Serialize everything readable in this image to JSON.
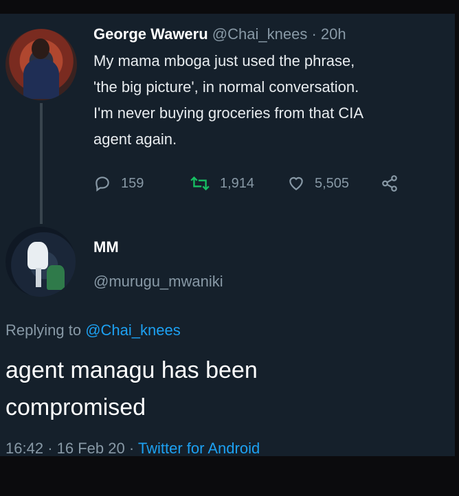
{
  "original_tweet": {
    "author_name": "George Waweru",
    "handle": "@Chai_knees",
    "separator": "·",
    "age": "20h",
    "text": "My mama mboga just used the phrase,\n'the big picture', in normal conversation.\nI'm never buying groceries from that CIA\nagent again.",
    "replies": "159",
    "retweets": "1,914",
    "likes": "5,505"
  },
  "reply_tweet": {
    "author_name": "MM",
    "handle": "@murugu_mwaniki",
    "replying_prefix": "Replying to",
    "replying_to": "@Chai_knees",
    "text": "agent managu has been\ncompromised",
    "time": "16:42",
    "date": "16 Feb 20",
    "separator": "·",
    "source": "Twitter for Android"
  },
  "icons": {
    "reply": "reply-icon",
    "retweet": "retweet-icon",
    "like": "heart-icon",
    "share": "share-icon"
  },
  "colors": {
    "background": "#15202b",
    "text": "#ffffff",
    "muted": "#8899a6",
    "link": "#1da1f2",
    "retweet_green": "#17bf63"
  }
}
